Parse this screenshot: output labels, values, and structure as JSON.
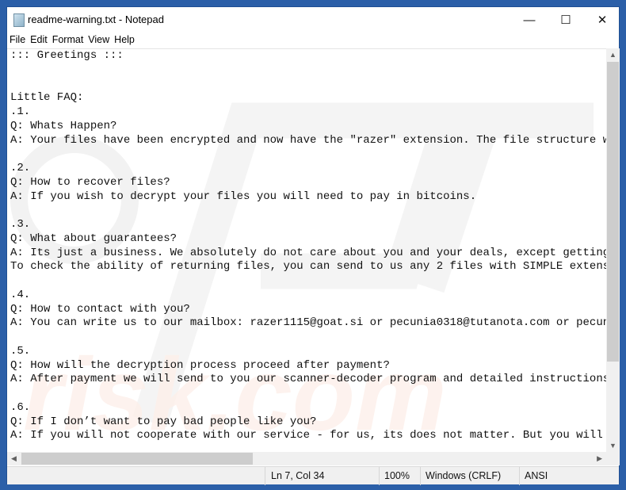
{
  "window": {
    "title": "readme-warning.txt - Notepad",
    "icon": "notepad-icon"
  },
  "controls": {
    "minimize": "—",
    "maximize": "☐",
    "close": "✕"
  },
  "menu": [
    "File",
    "Edit",
    "Format",
    "View",
    "Help"
  ],
  "editor": {
    "lines": [
      "::: Greetings :::",
      "",
      "",
      "Little FAQ:",
      ".1.",
      "Q: Whats Happen?",
      "A: Your files have been encrypted and now have the \"razer\" extension. The file structure w",
      "",
      ".2.",
      "Q: How to recover files?",
      "A: If you wish to decrypt your files you will need to pay in bitcoins.",
      "",
      ".3.",
      "Q: What about guarantees?",
      "A: Its just a business. We absolutely do not care about you and your deals, except getting",
      "To check the ability of returning files, you can send to us any 2 files with SIMPLE extens",
      "",
      ".4.",
      "Q: How to contact with you?",
      "A: You can write us to our mailbox: razer1115@goat.si or pecunia0318@tutanota.com or pecun",
      "",
      ".5.",
      "Q: How will the decryption process proceed after payment?",
      "A: After payment we will send to you our scanner-decoder program and detailed instructions",
      "",
      ".6.",
      "Q: If I don’t want to pay bad people like you?",
      "A: If you will not cooperate with our service - for us, its does not matter. But you will "
    ]
  },
  "status": {
    "position": "Ln 7, Col 34",
    "zoom": "100%",
    "line_ending": "Windows (CRLF)",
    "encoding": "ANSI"
  },
  "scroll": {
    "vertical_fraction": 0.0,
    "horizontal_fraction": 0.0
  }
}
